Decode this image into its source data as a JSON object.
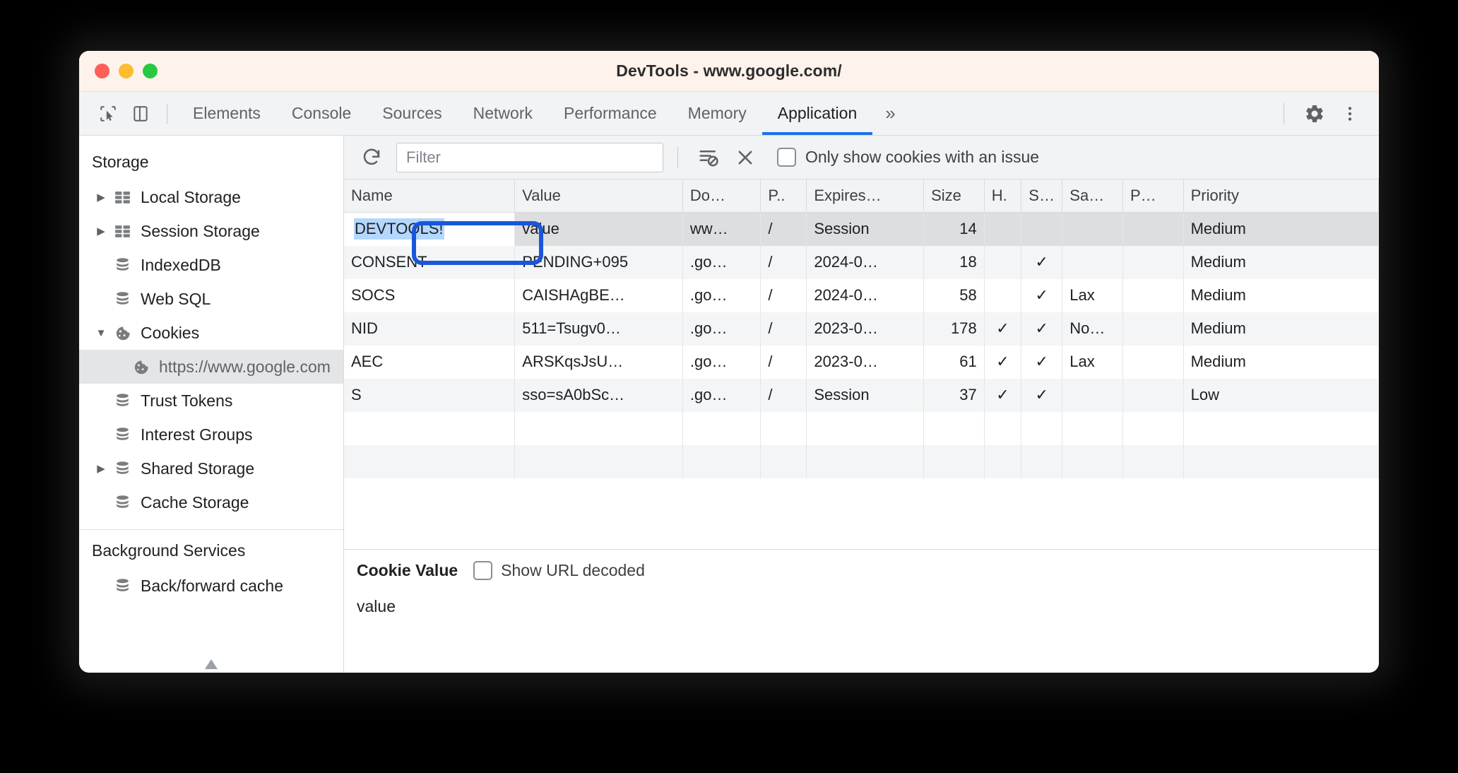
{
  "window": {
    "title": "DevTools - www.google.com/",
    "traffic_lights": [
      "close",
      "minimize",
      "zoom"
    ]
  },
  "toolbar": {
    "inspect_icon": "inspect-cursor-icon",
    "device_icon": "device-toolbar-icon",
    "tabs": [
      {
        "label": "Elements",
        "active": false
      },
      {
        "label": "Console",
        "active": false
      },
      {
        "label": "Sources",
        "active": false
      },
      {
        "label": "Network",
        "active": false
      },
      {
        "label": "Performance",
        "active": false
      },
      {
        "label": "Memory",
        "active": false
      },
      {
        "label": "Application",
        "active": true
      }
    ],
    "more_tabs": "»",
    "settings_icon": "gear-icon",
    "menu_icon": "kebab-menu-icon"
  },
  "sidebar": {
    "storage_section": "Storage",
    "storage_items": [
      {
        "label": "Local Storage",
        "icon": "table-grid-icon",
        "twisty": "right",
        "indent": 0,
        "selected": false
      },
      {
        "label": "Session Storage",
        "icon": "table-grid-icon",
        "twisty": "right",
        "indent": 0,
        "selected": false
      },
      {
        "label": "IndexedDB",
        "icon": "database-icon",
        "twisty": "none",
        "indent": 0,
        "selected": false
      },
      {
        "label": "Web SQL",
        "icon": "database-icon",
        "twisty": "none",
        "indent": 0,
        "selected": false
      },
      {
        "label": "Cookies",
        "icon": "cookie-icon",
        "twisty": "down",
        "indent": 0,
        "selected": false
      },
      {
        "label": "https://www.google.com",
        "icon": "cookie-icon",
        "twisty": "none",
        "indent": 1,
        "selected": true
      },
      {
        "label": "Trust Tokens",
        "icon": "database-icon",
        "twisty": "none",
        "indent": 0,
        "selected": false
      },
      {
        "label": "Interest Groups",
        "icon": "database-icon",
        "twisty": "none",
        "indent": 0,
        "selected": false
      },
      {
        "label": "Shared Storage",
        "icon": "database-icon",
        "twisty": "right",
        "indent": 0,
        "selected": false
      },
      {
        "label": "Cache Storage",
        "icon": "database-icon",
        "twisty": "none",
        "indent": 0,
        "selected": false
      }
    ],
    "background_section": "Background Services",
    "background_items": [
      {
        "label": "Back/forward cache",
        "icon": "database-icon",
        "twisty": "none",
        "indent": 0,
        "selected": false
      }
    ]
  },
  "filterbar": {
    "refresh_icon": "refresh-icon",
    "filter_placeholder": "Filter",
    "filter_value": "",
    "clear_filtered_icon": "clear-filtered-cookies-icon",
    "clear_all_icon": "close-x-icon",
    "issue_checkbox_checked": false,
    "issue_checkbox_label": "Only show cookies with an issue"
  },
  "table": {
    "columns": [
      "Name",
      "Value",
      "Do…",
      "P..",
      "Expires…",
      "Size",
      "H.",
      "S…",
      "Sa…",
      "P…",
      "Priority"
    ],
    "rows": [
      {
        "name": "DEVTOOLS!",
        "value": "value",
        "domain": "ww…",
        "path": "/",
        "expires": "Session",
        "size": "14",
        "httponly": "",
        "secure": "",
        "samesite": "",
        "partition": "",
        "priority": "Medium",
        "selected": true,
        "editing": true
      },
      {
        "name": "CONSENT",
        "value": "PENDING+095",
        "domain": ".go…",
        "path": "/",
        "expires": "2024-0…",
        "size": "18",
        "httponly": "",
        "secure": "✓",
        "samesite": "",
        "partition": "",
        "priority": "Medium",
        "selected": false,
        "editing": false
      },
      {
        "name": "SOCS",
        "value": "CAISHAgBE…",
        "domain": ".go…",
        "path": "/",
        "expires": "2024-0…",
        "size": "58",
        "httponly": "",
        "secure": "✓",
        "samesite": "Lax",
        "partition": "",
        "priority": "Medium",
        "selected": false,
        "editing": false
      },
      {
        "name": "NID",
        "value": "511=Tsugv0…",
        "domain": ".go…",
        "path": "/",
        "expires": "2023-0…",
        "size": "178",
        "httponly": "✓",
        "secure": "✓",
        "samesite": "No…",
        "partition": "",
        "priority": "Medium",
        "selected": false,
        "editing": false
      },
      {
        "name": "AEC",
        "value": "ARSKqsJsU…",
        "domain": ".go…",
        "path": "/",
        "expires": "2023-0…",
        "size": "61",
        "httponly": "✓",
        "secure": "✓",
        "samesite": "Lax",
        "partition": "",
        "priority": "Medium",
        "selected": false,
        "editing": false
      },
      {
        "name": "S",
        "value": "sso=sA0bSc…",
        "domain": ".go…",
        "path": "/",
        "expires": "Session",
        "size": "37",
        "httponly": "✓",
        "secure": "✓",
        "samesite": "",
        "partition": "",
        "priority": "Low",
        "selected": false,
        "editing": false
      }
    ]
  },
  "detail": {
    "title": "Cookie Value",
    "decode_checkbox_checked": false,
    "decode_label": "Show URL decoded",
    "value_text": "value"
  },
  "annotation": {
    "type": "rounded-rect-highlight",
    "color": "#1a56db",
    "target": "cookie-name-cell-devtools"
  }
}
